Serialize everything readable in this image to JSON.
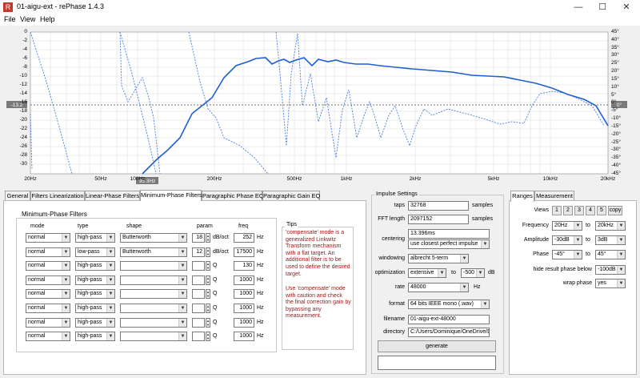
{
  "window": {
    "title": "01-aigu-ext  -  rePhase 1.4.3",
    "icon": "R",
    "min": "—",
    "max": "☐",
    "close": "✕"
  },
  "menu": [
    "File",
    "View",
    "Help"
  ],
  "plot": {
    "x_ticks": [
      "20Hz",
      "50Hz",
      "100Hz",
      "200Hz",
      "500Hz",
      "1kHz",
      "2kHz",
      "5kHz",
      "10kHz",
      "20kHz"
    ],
    "y_left": [
      "0",
      "-2",
      "-4",
      "-6",
      "-8",
      "-10",
      "-12",
      "-14",
      "-16",
      "-18",
      "-20",
      "-22",
      "-24",
      "-26",
      "-28",
      "-30"
    ],
    "y_right": [
      "45°",
      "40°",
      "35°",
      "30°",
      "25°",
      "20°",
      "15°",
      "10°",
      "5°",
      "0°",
      "-5°",
      "-10°",
      "-15°",
      "-20°",
      "-25°",
      "-30°",
      "-35°",
      "-40°",
      "-45°"
    ],
    "cursor_left": "-13.2",
    "cursor_right": "0°",
    "cursor_freq": "95.3Hz"
  },
  "left_tabs": [
    "General",
    "Filters Linearization",
    "Linear-Phase Filters",
    "Minimum-Phase Filters",
    "Paragraphic Phase EQ",
    "Paragraphic Gain EQ"
  ],
  "filters": {
    "group_title": "Minimum-Phase Filters",
    "headers": {
      "mode": "mode",
      "type": "type",
      "shape": "shape",
      "param": "param",
      "freq": "freq"
    },
    "rows": [
      {
        "mode": "normal",
        "type": "high-pass",
        "shape": "Butterworth",
        "param": "18",
        "unit": "dB/oct",
        "freq": "252",
        "hz": "Hz"
      },
      {
        "mode": "normal",
        "type": "low-pass",
        "shape": "Butterworth",
        "param": "12",
        "unit": "dB/oct",
        "freq": "17500",
        "hz": "Hz"
      },
      {
        "mode": "normal",
        "type": "high-pass",
        "shape": "",
        "param": "",
        "unit": "Q",
        "freq": "130",
        "hz": "Hz"
      },
      {
        "mode": "normal",
        "type": "high-pass",
        "shape": "",
        "param": "",
        "unit": "Q",
        "freq": "1000",
        "hz": "Hz"
      },
      {
        "mode": "normal",
        "type": "high-pass",
        "shape": "",
        "param": "",
        "unit": "Q",
        "freq": "1000",
        "hz": "Hz"
      },
      {
        "mode": "normal",
        "type": "high-pass",
        "shape": "",
        "param": "",
        "unit": "Q",
        "freq": "1000",
        "hz": "Hz"
      },
      {
        "mode": "normal",
        "type": "high-pass",
        "shape": "",
        "param": "",
        "unit": "Q",
        "freq": "1000",
        "hz": "Hz"
      },
      {
        "mode": "normal",
        "type": "high-pass",
        "shape": "",
        "param": "",
        "unit": "Q",
        "freq": "1000",
        "hz": "Hz"
      }
    ]
  },
  "tips": {
    "title": "Tips",
    "p1": "'compensate' mode is a generalized Linkwitz Transform mechanism with a flat target. An additional filter is to be used to define the desired target.",
    "p2": "Use 'compensate' mode with caution and check the final correction gain by bypassing any measurement."
  },
  "impulse": {
    "title": "Impulse Settings",
    "taps_label": "taps",
    "taps": "32768",
    "taps_unit": "samples",
    "fft_label": "FFT length",
    "fft": "2097152",
    "fft_unit": "samples",
    "centering_label": "centering",
    "centering_value": "13.396ms",
    "centering_mode": "use closest perfect impulse",
    "windowing_label": "windowing",
    "windowing": "albrecht 5-term",
    "opt_label": "optimization",
    "opt_mode": "extensive",
    "opt_to": "to",
    "opt_db": "-500",
    "opt_unit": "dB",
    "rate_label": "rate",
    "rate": "48000",
    "rate_unit": "Hz",
    "format_label": "format",
    "format": "64 bits IEEE mono (.wav)",
    "filename_label": "filename",
    "filename": "01-aigu-ext-48000",
    "directory_label": "directory",
    "directory": "C:/Users/Dominique/OneDrive/Do",
    "generate": "generate"
  },
  "right_tabs": [
    "Ranges",
    "Measurement"
  ],
  "ranges": {
    "views_label": "Views",
    "views": [
      "1",
      "2",
      "3",
      "4",
      "5"
    ],
    "copy": "copy",
    "frequency_label": "Frequency",
    "freq_from": "20Hz",
    "freq_to": "20kHz",
    "amplitude_label": "Amplitude",
    "amp_from": "-30dB",
    "amp_to": "3dB",
    "phase_label": "Phase",
    "phase_from": "-45°",
    "phase_to": "45°",
    "hide_label": "hide result phase below",
    "hide": "-100dB",
    "wrap_label": "wrap phase",
    "wrap": "yes",
    "to": "to"
  }
}
